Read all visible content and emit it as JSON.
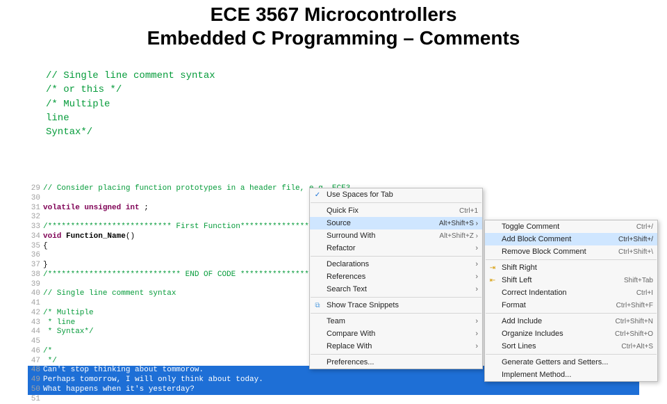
{
  "title": {
    "line1": "ECE 3567 Microcontrollers",
    "line2": "Embedded C Programming – Comments"
  },
  "bigcode": {
    "l1": "// Single line comment syntax",
    "l2": "/*  or this  */",
    "l3": " ",
    "l4": "/* Multiple",
    "l5": "   line",
    "l6": "   Syntax*/"
  },
  "ide": [
    {
      "n": "29",
      "cls": "comment",
      "t": "// Consider placing function prototypes in a header file, e.g. ECE3"
    },
    {
      "n": "30",
      "cls": "",
      "t": " "
    },
    {
      "n": "31",
      "cls": "kw",
      "t": "volatile unsigned int ;",
      "kwPrefix": 3
    },
    {
      "n": "32",
      "cls": "",
      "t": " "
    },
    {
      "n": "33",
      "cls": "comment",
      "t": "/*************************** First Function***************************"
    },
    {
      "n": "34",
      "cls": "",
      "t": "void Function_Name()",
      "fn": true
    },
    {
      "n": "35",
      "cls": "",
      "t": "{"
    },
    {
      "n": "36",
      "cls": "",
      "t": " "
    },
    {
      "n": "37",
      "cls": "",
      "t": "}"
    },
    {
      "n": "38",
      "cls": "comment",
      "t": "/***************************** END OF CODE ***************************"
    },
    {
      "n": "39",
      "cls": "",
      "t": " "
    },
    {
      "n": "40",
      "cls": "comment",
      "t": "// Single line comment syntax"
    },
    {
      "n": "41",
      "cls": "",
      "t": " "
    },
    {
      "n": "42",
      "cls": "comment",
      "t": "/* Multiple"
    },
    {
      "n": "43",
      "cls": "comment",
      "t": " * line"
    },
    {
      "n": "44",
      "cls": "comment",
      "t": " * Syntax*/"
    },
    {
      "n": "45",
      "cls": "",
      "t": " "
    },
    {
      "n": "46",
      "cls": "comment",
      "t": "/*"
    },
    {
      "n": "47",
      "cls": "comment",
      "t": " */"
    },
    {
      "n": "48",
      "cls": "sel",
      "t": "Can't stop thinking about tommorow."
    },
    {
      "n": "49",
      "cls": "sel",
      "t": "Perhaps tomorrow, I will only think about today."
    },
    {
      "n": "50",
      "cls": "sel",
      "t": "What happens when it's yesterday?"
    },
    {
      "n": "51",
      "cls": "",
      "t": " "
    }
  ],
  "menu1": [
    {
      "type": "item",
      "label": "Use Spaces for Tab",
      "icon": "check"
    },
    {
      "type": "sep"
    },
    {
      "type": "item",
      "label": "Quick Fix",
      "accel": "Ctrl+1"
    },
    {
      "type": "item",
      "label": "Source",
      "accel": "Alt+Shift+S ›",
      "hl": true
    },
    {
      "type": "item",
      "label": "Surround With",
      "accel": "Alt+Shift+Z ›"
    },
    {
      "type": "item",
      "label": "Refactor",
      "arrow": true
    },
    {
      "type": "sep"
    },
    {
      "type": "item",
      "label": "Declarations",
      "arrow": true
    },
    {
      "type": "item",
      "label": "References",
      "arrow": true
    },
    {
      "type": "item",
      "label": "Search Text",
      "arrow": true
    },
    {
      "type": "sep"
    },
    {
      "type": "item",
      "label": "Show Trace Snippets",
      "icon": "trace"
    },
    {
      "type": "sep"
    },
    {
      "type": "item",
      "label": "Team",
      "arrow": true
    },
    {
      "type": "item",
      "label": "Compare With",
      "arrow": true
    },
    {
      "type": "item",
      "label": "Replace With",
      "arrow": true
    },
    {
      "type": "sep"
    },
    {
      "type": "item",
      "label": "Preferences..."
    }
  ],
  "menu2": [
    {
      "type": "item",
      "label": "Toggle Comment",
      "accel": "Ctrl+/"
    },
    {
      "type": "item",
      "label": "Add Block Comment",
      "accel": "Ctrl+Shift+/",
      "hl": true
    },
    {
      "type": "item",
      "label": "Remove Block Comment",
      "accel": "Ctrl+Shift+\\"
    },
    {
      "type": "sep"
    },
    {
      "type": "item",
      "label": "Shift Right",
      "icon": "sr"
    },
    {
      "type": "item",
      "label": "Shift Left",
      "accel": "Shift+Tab",
      "icon": "sl"
    },
    {
      "type": "item",
      "label": "Correct Indentation",
      "accel": "Ctrl+I"
    },
    {
      "type": "item",
      "label": "Format",
      "accel": "Ctrl+Shift+F"
    },
    {
      "type": "sep"
    },
    {
      "type": "item",
      "label": "Add Include",
      "accel": "Ctrl+Shift+N"
    },
    {
      "type": "item",
      "label": "Organize Includes",
      "accel": "Ctrl+Shift+O"
    },
    {
      "type": "item",
      "label": "Sort Lines",
      "accel": "Ctrl+Alt+S"
    },
    {
      "type": "sep"
    },
    {
      "type": "item",
      "label": "Generate Getters and Setters..."
    },
    {
      "type": "item",
      "label": "Implement Method..."
    }
  ]
}
